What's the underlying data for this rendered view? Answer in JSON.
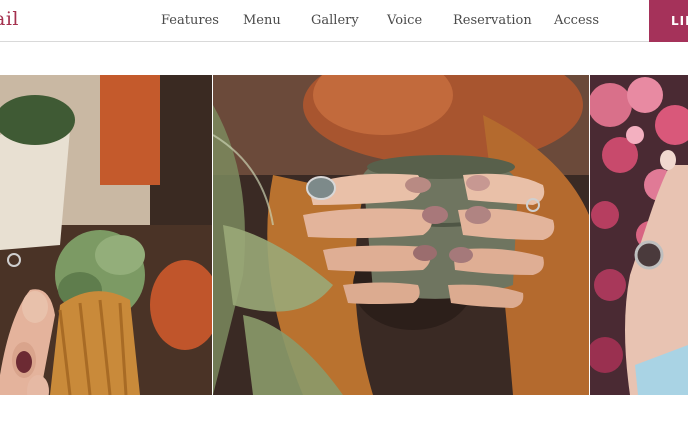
{
  "header": {
    "brand": "ail",
    "nav": [
      "Features",
      "Menu",
      "Gallery",
      "Voice",
      "Reservation",
      "Access"
    ],
    "cta_label": "LIN"
  },
  "gallery": {
    "photos": [
      {
        "subject": "hands with rings holding knitted sweater sleeve near succulent"
      },
      {
        "subject": "hands with painted nails holding ceramic mug"
      },
      {
        "subject": "hand with ring in front of pink flowers"
      }
    ]
  }
}
